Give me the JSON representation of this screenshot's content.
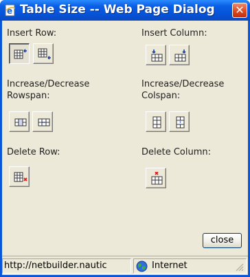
{
  "window": {
    "title": "Table Size -- Web Page Dialog",
    "close_glyph": "✕",
    "title_icon": "ie-document-icon"
  },
  "sections": {
    "insert_row": {
      "label": "Insert Row:",
      "buttons": [
        "insert-row-above-icon",
        "insert-row-below-icon"
      ],
      "active_index": 0
    },
    "insert_column": {
      "label": "Insert Column:",
      "buttons": [
        "insert-column-left-icon",
        "insert-column-right-icon"
      ]
    },
    "rowspan": {
      "label_line1": "Increase/Decrease",
      "label_line2": "Rowspan:",
      "buttons": [
        "increase-rowspan-icon",
        "decrease-rowspan-icon"
      ]
    },
    "colspan": {
      "label_line1": "Increase/Decrease",
      "label_line2": "Colspan:",
      "buttons": [
        "increase-colspan-icon",
        "decrease-colspan-icon"
      ]
    },
    "delete_row": {
      "label": "Delete Row:",
      "buttons": [
        "delete-row-icon"
      ]
    },
    "delete_column": {
      "label": "Delete Column:",
      "buttons": [
        "delete-column-icon"
      ]
    }
  },
  "actions": {
    "close_label": "close"
  },
  "statusbar": {
    "url": "http://netbuilder.nautic",
    "zone": "Internet",
    "zone_icon": "globe-icon"
  },
  "colors": {
    "titlebar": "#0a5fe5",
    "dialog_bg": "#ece9d8",
    "accent_arrow": "#1a3e9c",
    "delete_mark": "#e01818"
  }
}
